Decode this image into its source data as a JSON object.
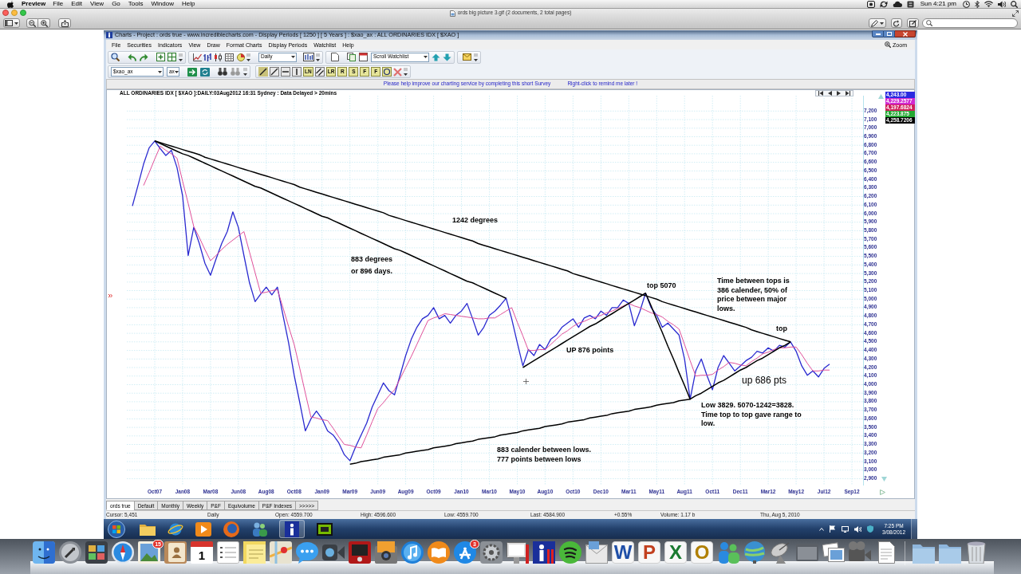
{
  "menu_bar": {
    "app": "Preview",
    "items": [
      "File",
      "Edit",
      "View",
      "Go",
      "Tools",
      "Window",
      "Help"
    ],
    "clock": "Sun 4:21 pm"
  },
  "preview_window": {
    "title": "ords big picture 3.gif (2 documents, 2 total pages)"
  },
  "charts_window": {
    "title": "Charts - Project : ords true - www.incrediblecharts.com - Display Periods [ 1250 ] [ 5 Years ] : $xao_ax : ALL ORDINARIES IDX [ $XAO ]",
    "menu": [
      "File",
      "Securities",
      "Indicators",
      "View",
      "Draw",
      "Format Charts",
      "Display Periods",
      "Watchlist",
      "Help"
    ],
    "zoom_label": "Zoom",
    "toolbar": {
      "period": "Daily",
      "watchlist": "Scroll Watchlist",
      "symbol": "$xao_ax",
      "exchange": "ax",
      "drawing_tools": [
        "LN",
        "LR",
        "R",
        "S",
        "F",
        "F"
      ]
    },
    "survey": {
      "message": "Please help improve our charting service by completing this short Survey",
      "hint": "Right-click to remind me later !"
    },
    "chart": {
      "header": "ALL ORDINARIES IDX [ $XAO ]:DAILY:03Aug2012 16:31 Sydney : Data Delayed > 20mins",
      "price_labels": [
        {
          "text": "4,243.00",
          "color": "#2a2ae0"
        },
        {
          "text": "4,229.2577",
          "color": "#d02ad0"
        },
        {
          "text": "4,197.6824",
          "color": "#d0205a"
        },
        {
          "text": "4,223.875",
          "color": "#23a832"
        },
        {
          "text": "4,258.7206",
          "color": "#000000"
        }
      ],
      "chart_data": [
        {
          "type": "line",
          "ylim": [
            2820,
            7380
          ],
          "grid": true,
          "categories": [
            null,
            null,
            null,
            null,
            "Oct07",
            null,
            null,
            null,
            null,
            "Jan08",
            null,
            null,
            null,
            null,
            "Mar08",
            null,
            null,
            null,
            null,
            "Jun08",
            null,
            null,
            null,
            null,
            "Aug08",
            null,
            null,
            null,
            null,
            "Oct08",
            null,
            null,
            null,
            null,
            "Jan09",
            null,
            null,
            null,
            null,
            "Mar09",
            null,
            null,
            null,
            null,
            "Jun09",
            null,
            null,
            null,
            null,
            "Aug09",
            null,
            null,
            null,
            null,
            "Oct09",
            null,
            null,
            null,
            null,
            "Jan10",
            null,
            null,
            null,
            null,
            "Mar10",
            null,
            null,
            null,
            null,
            "May10",
            null,
            null,
            null,
            null,
            "Aug10",
            null,
            null,
            null,
            null,
            "Oct10",
            null,
            null,
            null,
            null,
            "Dec10",
            null,
            null,
            null,
            null,
            "Mar11",
            null,
            null,
            null,
            null,
            "May11",
            null,
            null,
            null,
            null,
            "Aug11",
            null,
            null,
            null,
            null,
            "Oct11",
            null,
            null,
            null,
            null,
            "Dec11",
            null,
            null,
            null,
            null,
            "Mar12",
            null,
            null,
            null,
            null,
            "May12",
            null,
            null,
            null,
            null,
            "Jul12",
            null,
            null,
            null,
            null,
            "Sep12"
          ],
          "yticks": [
            {
              "value": 2900,
              "label": "2,900"
            },
            {
              "value": 3000,
              "label": "3,000"
            },
            {
              "value": 3100,
              "label": "3,100"
            },
            {
              "value": 3200,
              "label": "3,200"
            },
            {
              "value": 3300,
              "label": "3,300"
            },
            {
              "value": 3400,
              "label": "3,400"
            },
            {
              "value": 3500,
              "label": "3,500"
            },
            {
              "value": 3600,
              "label": "3,600"
            },
            {
              "value": 3700,
              "label": "3,700"
            },
            {
              "value": 3800,
              "label": "3,800"
            },
            {
              "value": 3900,
              "label": "3,900"
            },
            {
              "value": 4000,
              "label": "4,000"
            },
            {
              "value": 4100,
              "label": "4,100"
            },
            {
              "value": 4200,
              "label": "4,200"
            },
            {
              "value": 4300,
              "label": "4,300"
            },
            {
              "value": 4400,
              "label": "4,400"
            },
            {
              "value": 4500,
              "label": "4,500"
            },
            {
              "value": 4600,
              "label": "4,600"
            },
            {
              "value": 4700,
              "label": "4,700"
            },
            {
              "value": 4800,
              "label": "4,800"
            },
            {
              "value": 4900,
              "label": "4,900"
            },
            {
              "value": 5000,
              "label": "5,000"
            },
            {
              "value": 5100,
              "label": "5,100"
            },
            {
              "value": 5200,
              "label": "5,200"
            },
            {
              "value": 5300,
              "label": "5,300"
            },
            {
              "value": 5400,
              "label": "5,400"
            },
            {
              "value": 5500,
              "label": "5,500"
            },
            {
              "value": 5600,
              "label": "5,600"
            },
            {
              "value": 5700,
              "label": "5,700"
            },
            {
              "value": 5800,
              "label": "5,800"
            },
            {
              "value": 5900,
              "label": "5,900"
            },
            {
              "value": 6000,
              "label": "6,000"
            },
            {
              "value": 6100,
              "label": "6,100"
            },
            {
              "value": 6200,
              "label": "6,200"
            },
            {
              "value": 6300,
              "label": "6,300"
            },
            {
              "value": 6400,
              "label": "6,400"
            },
            {
              "value": 6500,
              "label": "6,500"
            },
            {
              "value": 6600,
              "label": "6,600"
            },
            {
              "value": 6700,
              "label": "6,700"
            },
            {
              "value": 6800,
              "label": "6,800"
            },
            {
              "value": 6900,
              "label": "6,900"
            },
            {
              "value": 7000,
              "label": "7,000"
            },
            {
              "value": 7100,
              "label": "7,100"
            },
            {
              "value": 7200,
              "label": "7,200"
            }
          ],
          "series": [
            {
              "color": "#2a2ad0",
              "values": [
                6090,
                6330,
                6580,
                6770,
                6850,
                6760,
                6680,
                6740,
                6540,
                6210,
                5510,
                5840,
                5650,
                5420,
                5280,
                5470,
                5650,
                5790,
                6020,
                5840,
                5510,
                5190,
                4970,
                5060,
                5140,
                5050,
                5140,
                4810,
                4490,
                4110,
                3790,
                3460,
                3600,
                3690,
                3600,
                3460,
                3410,
                3320,
                3180,
                3110,
                3270,
                3410,
                3550,
                3740,
                3880,
                4020,
                3930,
                3880,
                4110,
                4340,
                4530,
                4670,
                4770,
                4810,
                4900,
                4770,
                4810,
                4720,
                4810,
                4860,
                4950,
                4770,
                4580,
                4670,
                4810,
                4860,
                4930,
                5010,
                4770,
                4490,
                4220,
                4410,
                4340,
                4470,
                4410,
                4530,
                4580,
                4670,
                4720,
                4770,
                4670,
                4780,
                4810,
                4770,
                4860,
                4810,
                4900,
                4900,
                4990,
                4950,
                4690,
                4860,
                5070,
                4900,
                4810,
                4670,
                4720,
                4650,
                4580,
                4300,
                3830,
                4160,
                4300,
                4110,
                3940,
                4200,
                4340,
                4250,
                4160,
                4220,
                4280,
                4320,
                4390,
                4370,
                4430,
                4390,
                4460,
                4440,
                4500,
                4390,
                4220,
                4110,
                4160,
                4090,
                4190,
                4240,
                null,
                null,
                null,
                null
              ]
            },
            {
              "color": "#e0509a",
              "values": [
                null,
                null,
                6330,
                6480,
                6640,
                6790,
                6740,
                6700,
                6650,
                6380,
                6120,
                5850,
                5720,
                5580,
                5450,
                5510,
                5580,
                5640,
                5690,
                5740,
                5790,
                5550,
                5310,
                5070,
                5080,
                5100,
                5110,
                4900,
                4680,
                4470,
                4190,
                3900,
                3620,
                3610,
                3590,
                3580,
                3490,
                3390,
                3300,
                3290,
                3270,
                3260,
                3410,
                3570,
                3720,
                3790,
                3870,
                3940,
                4070,
                4200,
                4330,
                4470,
                4610,
                4750,
                4780,
                4800,
                4830,
                4820,
                4810,
                4800,
                4790,
                4780,
                4770,
                4770,
                4780,
                4780,
                4820,
                4860,
                4900,
                4730,
                4570,
                4400,
                4400,
                4410,
                4410,
                4470,
                4530,
                4590,
                4630,
                4680,
                4720,
                4740,
                4770,
                4790,
                4810,
                4840,
                4860,
                4890,
                4920,
                4950,
                4920,
                4900,
                4870,
                4840,
                4820,
                4790,
                4740,
                4700,
                4650,
                4470,
                4280,
                4100,
                4110,
                4110,
                4120,
                4170,
                4210,
                4260,
                4250,
                4230,
                4220,
                4270,
                4310,
                4360,
                4380,
                4410,
                4430,
                4430,
                4440,
                4440,
                4350,
                4250,
                4160,
                4160,
                4170,
                4170,
                null,
                null,
                null,
                null
              ]
            },
            {
              "color": "#000000",
              "values": [
                null,
                null,
                null,
                null,
                6850,
                6820,
                6790,
                6760,
                6730,
                6700,
                6680,
                6650,
                6620,
                6590,
                6560,
                6530,
                6500,
                6470,
                6440,
                6410,
                6380,
                6350,
                6320,
                6300,
                6270,
                6240,
                6210,
                6180,
                6150,
                6120,
                6090,
                6060,
                6030,
                6000,
                5970,
                5950,
                5920,
                5890,
                5860,
                5830,
                5800,
                5770,
                5740,
                5710,
                5680,
                5650,
                5620,
                5590,
                5570,
                5540,
                5510,
                5480,
                5450,
                5420,
                5390,
                5360,
                5330,
                5300,
                5270,
                5240,
                5210,
                5190,
                5160,
                5130,
                5100,
                5070,
                5040,
                5010,
                null,
                null,
                null,
                null,
                null,
                null,
                null,
                null,
                null,
                null,
                null,
                null,
                null,
                null,
                null,
                null,
                null,
                null,
                null,
                null,
                null,
                null,
                null,
                null,
                null,
                null,
                null,
                null,
                null,
                null,
                null,
                null,
                null,
                null,
                null,
                null,
                null,
                null,
                null,
                null,
                null,
                null,
                null,
                null,
                null,
                null,
                null,
                null,
                null,
                null,
                null,
                null,
                null,
                null,
                null,
                null,
                null,
                null,
                null,
                null,
                null,
                null
              ]
            },
            {
              "color": "#000000",
              "values": [
                null,
                null,
                null,
                null,
                6850,
                6830,
                6810,
                6790,
                6770,
                6750,
                6730,
                6710,
                6690,
                6660,
                6640,
                6620,
                6600,
                6580,
                6560,
                6540,
                6520,
                6500,
                6480,
                6460,
                6440,
                6420,
                6400,
                6380,
                6360,
                6340,
                6310,
                6290,
                6270,
                6250,
                6230,
                6210,
                6190,
                6170,
                6150,
                6130,
                6110,
                6090,
                6070,
                6050,
                6030,
                6010,
                5980,
                5960,
                5940,
                5920,
                5900,
                5880,
                5860,
                5840,
                5820,
                5800,
                5780,
                5760,
                5740,
                5720,
                5700,
                5680,
                5650,
                5630,
                5610,
                5590,
                5570,
                5550,
                5530,
                5510,
                5490,
                5470,
                5450,
                5430,
                5410,
                5390,
                5370,
                5350,
                5330,
                5300,
                5280,
                5260,
                5240,
                5220,
                5200,
                5180,
                5160,
                5140,
                5120,
                5100,
                5080,
                5060,
                5040,
                5020,
                5000,
                4970,
                4950,
                4930,
                4910,
                4890,
                4870,
                4850,
                4830,
                4810,
                4790,
                4770,
                4750,
                4730,
                4710,
                4690,
                4670,
                4640,
                4620,
                4600,
                4580,
                4560,
                4540,
                4520,
                4500,
                null,
                null,
                null,
                null,
                null,
                null,
                null,
                null,
                null,
                null,
                null
              ]
            },
            {
              "color": "#000000",
              "values": [
                null,
                null,
                null,
                null,
                null,
                null,
                null,
                null,
                null,
                null,
                null,
                null,
                null,
                null,
                null,
                null,
                null,
                null,
                null,
                null,
                null,
                null,
                null,
                null,
                null,
                null,
                null,
                null,
                null,
                null,
                null,
                null,
                null,
                null,
                null,
                null,
                null,
                null,
                null,
                3070,
                3080,
                3100,
                3110,
                3120,
                3130,
                3150,
                3160,
                3170,
                3180,
                3200,
                3210,
                3220,
                3230,
                3240,
                3260,
                3270,
                3280,
                3290,
                3310,
                3320,
                3330,
                3340,
                3360,
                3370,
                3380,
                3390,
                3410,
                3420,
                3430,
                3440,
                3460,
                3470,
                3480,
                3490,
                3510,
                3520,
                3530,
                3540,
                3560,
                3570,
                3580,
                3590,
                3610,
                3620,
                3630,
                3640,
                3660,
                3670,
                3680,
                3690,
                3710,
                3720,
                3730,
                3740,
                3760,
                3770,
                3780,
                3790,
                3810,
                3820,
                3830,
                null,
                null,
                null,
                null,
                null,
                null,
                null,
                null,
                null,
                null,
                null,
                null,
                null,
                null,
                null,
                null,
                null,
                null,
                null,
                null,
                null,
                null,
                null,
                null,
                null,
                null,
                null,
                null,
                null
              ]
            },
            {
              "color": "#000000",
              "values": [
                null,
                null,
                null,
                null,
                null,
                null,
                null,
                null,
                null,
                null,
                null,
                null,
                null,
                null,
                null,
                null,
                null,
                null,
                null,
                null,
                null,
                null,
                null,
                null,
                null,
                null,
                null,
                null,
                null,
                null,
                null,
                null,
                null,
                null,
                null,
                null,
                null,
                null,
                null,
                null,
                null,
                null,
                null,
                null,
                null,
                null,
                null,
                null,
                null,
                null,
                null,
                null,
                null,
                null,
                null,
                null,
                null,
                null,
                null,
                null,
                null,
                null,
                null,
                null,
                null,
                null,
                null,
                null,
                null,
                null,
                4200,
                4240,
                4280,
                4320,
                4360,
                4400,
                4440,
                4480,
                4520,
                4560,
                4600,
                4640,
                4680,
                4710,
                4750,
                4790,
                4830,
                4870,
                4910,
                4950,
                4990,
                5030,
                5070,
                4920,
                4760,
                4610,
                4450,
                4300,
                4140,
                3990,
                3830,
                3870,
                3900,
                3940,
                3980,
                4020,
                4050,
                4090,
                4130,
                4170,
                4200,
                4240,
                4280,
                4310,
                4350,
                4390,
                4430,
                4460,
                4500,
                null,
                null,
                null,
                null,
                null,
                null,
                null,
                null,
                null,
                null,
                null
              ]
            }
          ],
          "annotations": [
            "1242 degrees",
            "883 degrees or 896 days.",
            "top 5070",
            "Time between tops is 386 calender, 50% of price between major lows.",
            "top",
            "UP 876 points",
            "up 686 pts",
            "Low 3829. 5070-1242=3828. Time top to top gave range to low.",
            "883 calender between lows. 777 points between lows"
          ]
        }
      ]
    },
    "tabs": [
      {
        "label": "ords true",
        "selected": true
      },
      {
        "label": "Default",
        "selected": false
      },
      {
        "label": "Monthly",
        "selected": false
      },
      {
        "label": "Weekly",
        "selected": false
      },
      {
        "label": "P&F",
        "selected": false
      },
      {
        "label": "Equivolume",
        "selected": false
      },
      {
        "label": "P&F Indexes",
        "selected": false
      },
      {
        "label": ">>>>>",
        "selected": false
      }
    ],
    "status_bar": [
      "Cursor: 5,451",
      "Daily",
      "Open: 4559.700",
      "High: 4596.600",
      "Low: 4559.700",
      "Last: 4584.900",
      "+0.55%",
      "Volume: 1.17 b",
      "Thu, Aug 5, 2010"
    ]
  },
  "taskbar": {
    "time": "7:25 PM",
    "date": "3/08/2012"
  },
  "dock": {
    "badges": [
      "15",
      "3"
    ],
    "calendar_day": "1",
    "letters": [
      "W",
      "P",
      "X",
      "O"
    ]
  }
}
